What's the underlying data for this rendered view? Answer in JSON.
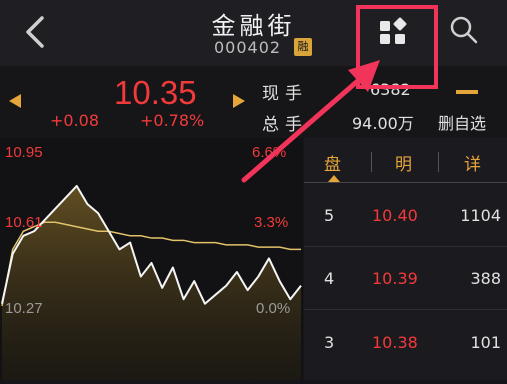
{
  "header": {
    "title": "金融街",
    "code": "000402",
    "badge": "融"
  },
  "quote": {
    "price": "10.35",
    "change": "+0.08",
    "change_pct": "+0.78%",
    "now_label": "现手",
    "now_value": "6382",
    "total_label": "总手",
    "total_value": "94.00万",
    "watchlist_label": "删自选"
  },
  "chart": {
    "y_high": "10.95",
    "y_mid": "10.61",
    "y_low": "10.27",
    "pct_high": "6.6%",
    "pct_mid": "3.3%",
    "pct_low": "0.0%"
  },
  "book": {
    "tabs": [
      "盘",
      "明",
      "详"
    ],
    "rows": [
      {
        "level": "5",
        "price": "10.40",
        "qty": "1104"
      },
      {
        "level": "4",
        "price": "10.39",
        "qty": "388"
      },
      {
        "level": "3",
        "price": "10.38",
        "qty": "101"
      }
    ]
  },
  "colors": {
    "up": "#f23a3a",
    "accent": "#e6a53a",
    "annotation": "#f2345a"
  },
  "icons": [
    "back-chevron-icon",
    "apps-grid-icon",
    "search-icon",
    "arrow-left-icon",
    "arrow-right-icon"
  ],
  "chart_data": {
    "type": "line",
    "series": [
      {
        "values": [
          10.28,
          10.5,
          10.58,
          10.6,
          10.65,
          10.7,
          10.75,
          10.8,
          10.72,
          10.68,
          10.6,
          10.52,
          10.55,
          10.4,
          10.46,
          10.35,
          10.44,
          10.3,
          10.38,
          10.28,
          10.32,
          10.36,
          10.42,
          10.34,
          10.4,
          10.48,
          10.38,
          10.3,
          10.36
        ]
      },
      {
        "values": [
          10.27,
          10.52,
          10.6,
          10.62,
          10.64,
          10.64,
          10.63,
          10.62,
          10.61,
          10.6,
          10.6,
          10.59,
          10.58,
          10.58,
          10.57,
          10.57,
          10.56,
          10.56,
          10.55,
          10.55,
          10.55,
          10.54,
          10.54,
          10.54,
          10.53,
          10.53,
          10.53,
          10.52,
          10.52
        ]
      }
    ],
    "ylim": [
      10.27,
      10.95
    ],
    "grid": false
  }
}
